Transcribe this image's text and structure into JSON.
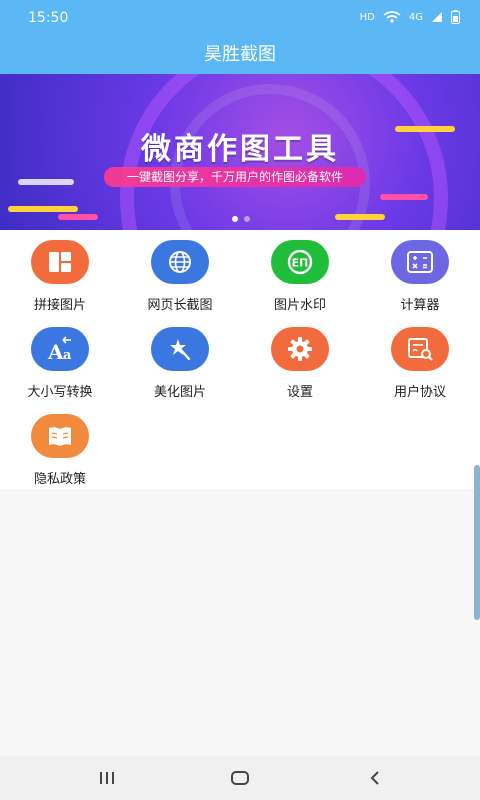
{
  "status": {
    "time": "15:50",
    "hd": "HD",
    "network": "4G"
  },
  "header": {
    "title": "昊胜截图"
  },
  "banner": {
    "headline": "微商作图工具",
    "subtitle": "一键截图分享，千万用户的作图必备软件"
  },
  "grid": {
    "items": [
      {
        "label": "拼接图片",
        "icon": "collage-icon",
        "color": "#f26b3d"
      },
      {
        "label": "网页长截图",
        "icon": "globe-icon",
        "color": "#3b77e0"
      },
      {
        "label": "图片水印",
        "icon": "watermark-icon",
        "color": "#1fbd3a"
      },
      {
        "label": "计算器",
        "icon": "calculator-icon",
        "color": "#6d67e3"
      },
      {
        "label": "大小写转换",
        "icon": "case-convert-icon",
        "color": "#3b77e0"
      },
      {
        "label": "美化图片",
        "icon": "magic-wand-icon",
        "color": "#3b77e0"
      },
      {
        "label": "设置",
        "icon": "gear-icon",
        "color": "#f26b3d"
      },
      {
        "label": "用户协议",
        "icon": "document-search-icon",
        "color": "#f26b3d"
      },
      {
        "label": "隐私政策",
        "icon": "book-icon",
        "color": "#f28a3d"
      }
    ]
  },
  "navbar": {
    "buttons": [
      "recent-apps",
      "home",
      "back"
    ]
  }
}
